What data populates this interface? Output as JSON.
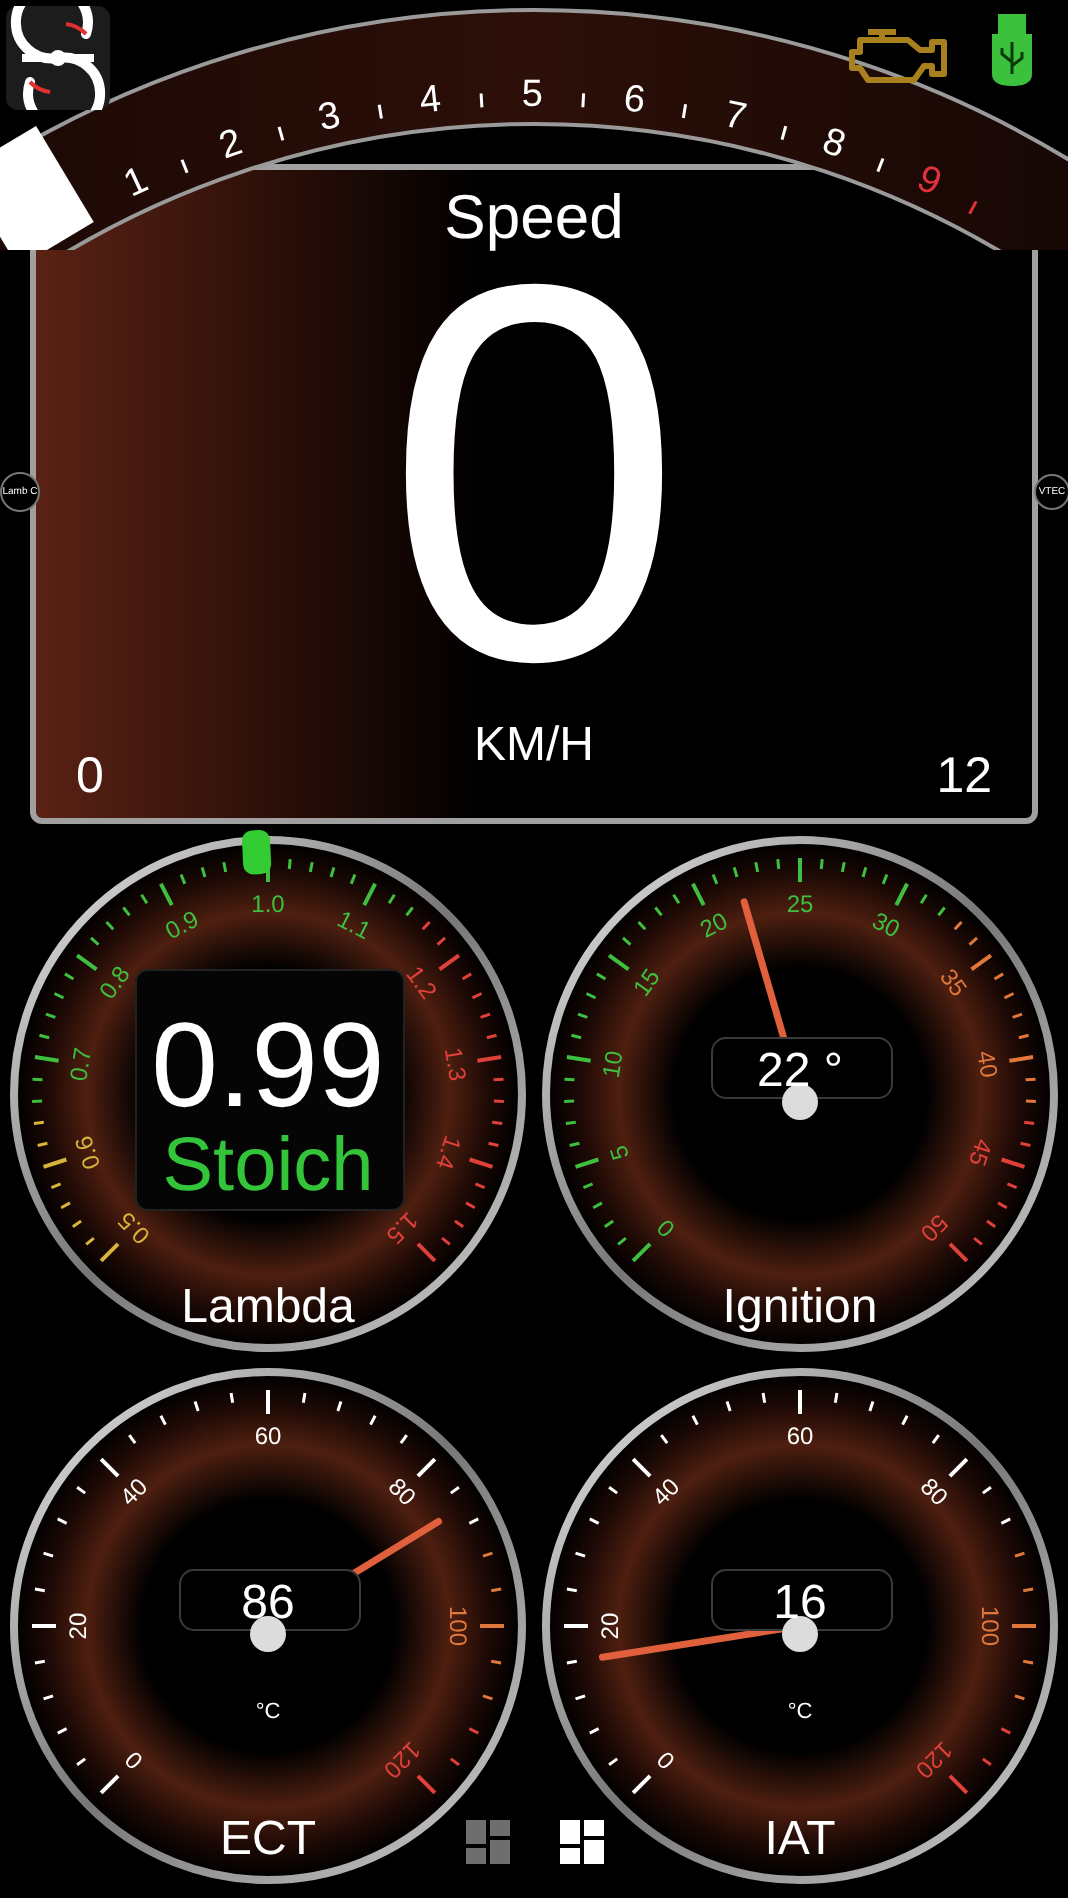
{
  "tachometer": {
    "labels": [
      {
        "label": "1",
        "color": "#ffffff"
      },
      {
        "label": "2",
        "color": "#ffffff"
      },
      {
        "label": "3",
        "color": "#ffffff"
      },
      {
        "label": "4",
        "color": "#ffffff"
      },
      {
        "label": "5",
        "color": "#ffffff"
      },
      {
        "label": "6",
        "color": "#ffffff"
      },
      {
        "label": "7",
        "color": "#ffffff"
      },
      {
        "label": "8",
        "color": "#ffffff"
      },
      {
        "label": "9",
        "color": "#e0323c"
      }
    ]
  },
  "side_indicators": [
    "Lamb C",
    "VTEC"
  ],
  "speed": {
    "title": "Speed",
    "value": "0",
    "unit": "KM/H",
    "min": "0",
    "max": "12"
  },
  "gauges": [
    {
      "kind": "lambda",
      "title": "Lambda",
      "value": "0.99",
      "status": "Stoich",
      "scale": [
        {
          "label": "0.5",
          "color": "#d8b43a"
        },
        {
          "label": "0.6",
          "color": "#d8b43a"
        },
        {
          "label": "0.7",
          "color": "#3fbf3f"
        },
        {
          "label": "0.8",
          "color": "#3fbf3f"
        },
        {
          "label": "0.9",
          "color": "#3fbf3f"
        },
        {
          "label": "1.0",
          "color": "#3fbf3f"
        },
        {
          "label": "1.1",
          "color": "#3fbf3f"
        },
        {
          "label": "1.2",
          "color": "#e0403a"
        },
        {
          "label": "1.3",
          "color": "#e0403a"
        },
        {
          "label": "1.4",
          "color": "#e0403a"
        },
        {
          "label": "1.5",
          "color": "#e0403a"
        }
      ]
    },
    {
      "kind": "needle",
      "title": "Ignition",
      "value": "22 °",
      "scale": [
        {
          "label": "0",
          "color": "#3fbf3f"
        },
        {
          "label": "5",
          "color": "#3fbf3f"
        },
        {
          "label": "10",
          "color": "#3fbf3f"
        },
        {
          "label": "15",
          "color": "#3fbf3f"
        },
        {
          "label": "20",
          "color": "#3fbf3f"
        },
        {
          "label": "25",
          "color": "#3fbf3f"
        },
        {
          "label": "30",
          "color": "#3fbf3f"
        },
        {
          "label": "35",
          "color": "#e0783c"
        },
        {
          "label": "40",
          "color": "#e0783c"
        },
        {
          "label": "45",
          "color": "#e0403a"
        },
        {
          "label": "50",
          "color": "#e0403a"
        }
      ]
    },
    {
      "kind": "needle",
      "title": "ECT",
      "value": "86",
      "unit": "°C",
      "scale": [
        {
          "label": "0",
          "color": "#ffffff"
        },
        {
          "label": "20",
          "color": "#ffffff"
        },
        {
          "label": "40",
          "color": "#ffffff"
        },
        {
          "label": "60",
          "color": "#ffffff"
        },
        {
          "label": "80",
          "color": "#ffffff"
        },
        {
          "label": "100",
          "color": "#e0783c"
        },
        {
          "label": "120",
          "color": "#e0403a"
        }
      ]
    },
    {
      "kind": "needle",
      "title": "IAT",
      "value": "16",
      "unit": "°C",
      "scale": [
        {
          "label": "0",
          "color": "#ffffff"
        },
        {
          "label": "20",
          "color": "#ffffff"
        },
        {
          "label": "40",
          "color": "#ffffff"
        },
        {
          "label": "60",
          "color": "#ffffff"
        },
        {
          "label": "80",
          "color": "#ffffff"
        },
        {
          "label": "100",
          "color": "#e0783c"
        },
        {
          "label": "120",
          "color": "#e0403a"
        }
      ]
    }
  ],
  "pages": [
    {
      "selected": false
    },
    {
      "selected": true
    }
  ]
}
